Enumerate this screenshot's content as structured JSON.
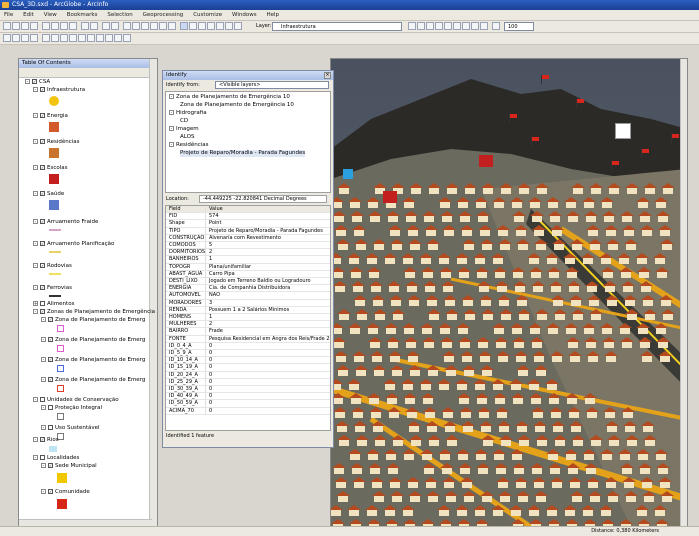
{
  "window": {
    "title": "CSA_3D.sxd - ArcGlobe - ArcInfo"
  },
  "menu": [
    "File",
    "Edit",
    "View",
    "Bookmarks",
    "Selection",
    "Geoprocessing",
    "Customize",
    "Windows",
    "Help"
  ],
  "toolbar": {
    "layer_label": "Layer:",
    "layer_value": "Infraestrutura",
    "zoom_value": "100"
  },
  "toc": {
    "title": "Table Of Contents",
    "layers": [
      {
        "label": "CSA",
        "checked": true
      },
      {
        "label": "Infraestrutura",
        "checked": true
      },
      {
        "label": "Energia",
        "checked": true
      },
      {
        "label": "Residências",
        "checked": true
      },
      {
        "label": "Escolas",
        "checked": true
      },
      {
        "label": "Saúde",
        "checked": true
      },
      {
        "label": "Arruamento Fraide",
        "checked": true
      },
      {
        "label": "Arruamento Planificação",
        "checked": true
      },
      {
        "label": "Rodovias",
        "checked": true
      },
      {
        "label": "Ferrovias",
        "checked": true
      },
      {
        "label": "Alimentos",
        "checked": false
      },
      {
        "label": "Zonas de Planejamento de Emergência",
        "checked": true
      },
      {
        "label": "Zona de Planejamento de Emerg",
        "checked": true
      },
      {
        "label": "Zona de Planejamento de Emerg",
        "checked": true
      },
      {
        "label": "Zona de Planejamento de Emerg",
        "checked": true
      },
      {
        "label": "Zona de Planejamento de Emerg",
        "checked": true
      },
      {
        "label": "Unidades de Conservação",
        "checked": false
      },
      {
        "label": "Proteção Integral",
        "checked": false
      },
      {
        "label": "Uso Sustentável",
        "checked": false
      },
      {
        "label": "Rios",
        "checked": true
      },
      {
        "label": "Localidades",
        "checked": false
      },
      {
        "label": "Sede Municipal",
        "checked": true
      },
      {
        "label": "Comunidade",
        "checked": true
      }
    ]
  },
  "identify": {
    "title": "Identify",
    "from_label": "Identify from:",
    "from_value": "<Visible layers>",
    "tree": [
      "Zona de Planejamento de Emergência 10",
      "Zona de Planejamento de Emergência 10",
      "Hidrografia",
      "CD",
      "Imagem",
      "ALOS",
      "Residências",
      "Projeto de Reparo/Moradia - Parada Fagundes"
    ],
    "location_label": "Location:",
    "location_value": "-44.449225  -22.820841 Decimal Degrees",
    "field_header": "Field",
    "value_header": "Value",
    "rows": [
      {
        "f": "FID",
        "v": "574"
      },
      {
        "f": "Shape",
        "v": "Point"
      },
      {
        "f": "TIPO",
        "v": "Projeto de Reparo/Moradia - Parada Fagundes"
      },
      {
        "f": "CONSTRUÇÃO",
        "v": "Alvenaria com Revestimento"
      },
      {
        "f": "COMODOS",
        "v": "5"
      },
      {
        "f": "DORMITORIOS",
        "v": "2"
      },
      {
        "f": "BANHEIROS",
        "v": "1"
      },
      {
        "f": "TOPOGR",
        "v": "Plana/unifamiliar"
      },
      {
        "f": "ABAST_AGUA",
        "v": "Carro Pipa"
      },
      {
        "f": "DESTI_LIXO",
        "v": "Jogado em Terreno Baldio ou Logradouro"
      },
      {
        "f": "ENERGIA",
        "v": "Cia. de Companhia Distribuidora"
      },
      {
        "f": "AUTOMOVEL",
        "v": "NÃO"
      },
      {
        "f": "MORADORES",
        "v": "3"
      },
      {
        "f": "RENDA",
        "v": "Possuem 1 a 2 Salários Mínimos"
      },
      {
        "f": "HOMENS",
        "v": "1"
      },
      {
        "f": "MULHERES",
        "v": "2"
      },
      {
        "f": "BAIRRO",
        "v": "Frade"
      },
      {
        "f": "FONTE",
        "v": "Pesquisa Residencial em Angra dos Reis/Frade 2"
      },
      {
        "f": "ID_0_4_A",
        "v": "0"
      },
      {
        "f": "ID_5_9_A",
        "v": "0"
      },
      {
        "f": "ID_10_14_A",
        "v": "0"
      },
      {
        "f": "ID_15_19_A",
        "v": "0"
      },
      {
        "f": "ID_20_24_A",
        "v": "0"
      },
      {
        "f": "ID_25_29_A",
        "v": "0"
      },
      {
        "f": "ID_30_39_A",
        "v": "0"
      },
      {
        "f": "ID_40_49_A",
        "v": "0"
      },
      {
        "f": "ID_50_59_A",
        "v": "0"
      },
      {
        "f": "ACIMA_70",
        "v": "0"
      }
    ],
    "status": "Identified 1 feature"
  },
  "statusbar": {
    "coords": "Distance: 0,380 Kilometers"
  },
  "colors": {
    "title_bar": "#1b3f95",
    "road": "#e3a21a",
    "roof": "#b54a1f",
    "flag": "#d9261c",
    "background_green": "#7fb541"
  }
}
